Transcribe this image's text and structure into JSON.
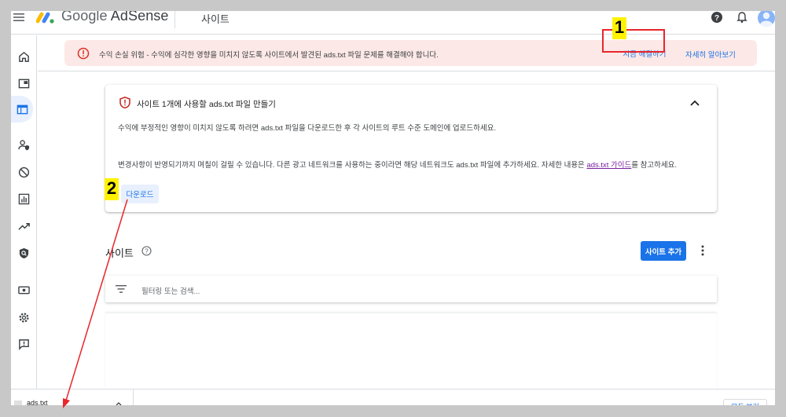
{
  "topbar": {
    "product_google": "Google",
    "product_name": "AdSense",
    "page_title": "사이트"
  },
  "alert": {
    "text": "수익 손실 위험 - 수익에 심각한 영향을 미치지 않도록 사이트에서 발견된 ads.txt 파일 문제를 해결해야 합니다.",
    "fix_label": "지금 해결하기",
    "learn_label": "자세히 알아보기"
  },
  "annotations": {
    "step1": "1",
    "step2": "2"
  },
  "card": {
    "title": "사이트 1개에 사용할 ads.txt 파일 만들기",
    "p1": "수익에 부정적인 영향이 미치지 않도록 하려면 ads.txt 파일을 다운로드한 후 각 사이트의 루트 수준 도메인에 업로드하세요.",
    "p2_before": "변경사항이 반영되기까지 며칠이 걸릴 수 있습니다. 다른 광고 네트워크를 사용하는 중이라면 해당 네트워크도 ads.txt 파일에 추가하세요. 자세한 내용은 ",
    "p2_link": "ads.txt 가이드",
    "p2_after": "를 참고하세요.",
    "download_label": "다운로드"
  },
  "sites": {
    "title": "사이트",
    "add_label": "사이트 추가",
    "filter_placeholder": "필터링 또는 검색..."
  },
  "downloads": {
    "file_name": "ads.txt",
    "show_all": "모두 보기"
  },
  "colors": {
    "accent": "#1a73e8",
    "alert_bg": "#fce8e6",
    "annotation_yellow": "#fff200",
    "annotation_red": "#e8262b"
  }
}
